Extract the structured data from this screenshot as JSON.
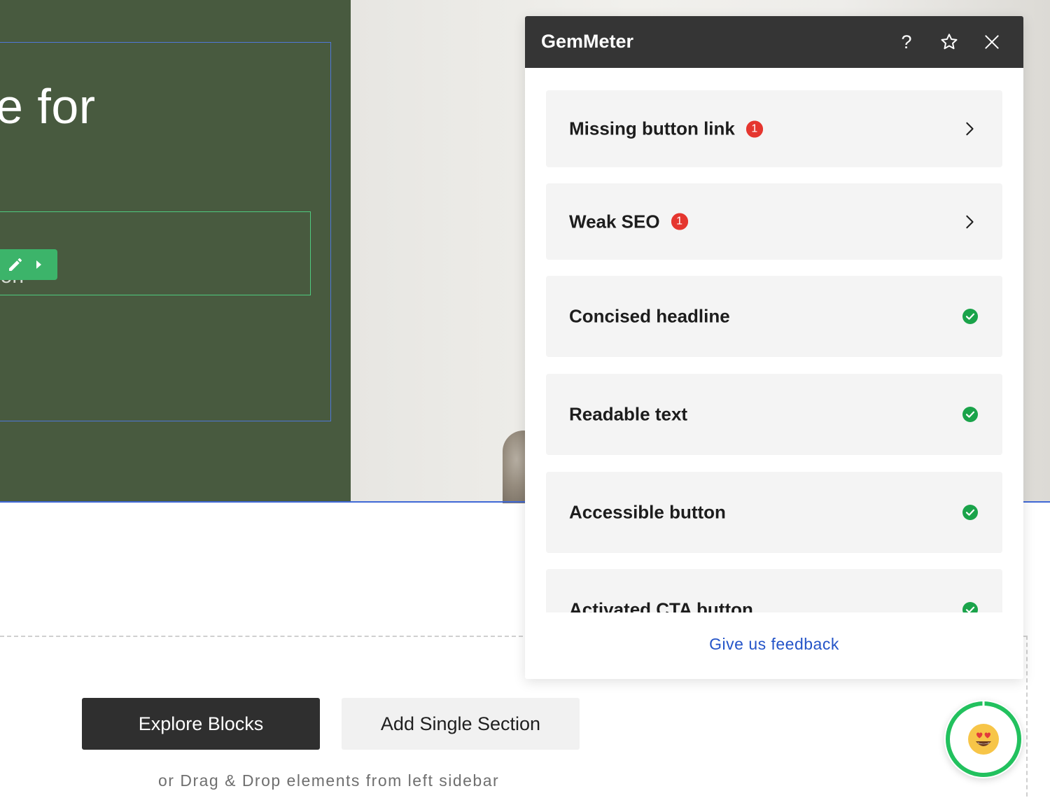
{
  "canvas": {
    "heading_fragment": "e for",
    "subtext_fragment": "ion"
  },
  "drop_zone": {
    "explore_label": "Explore Blocks",
    "add_section_label": "Add Single Section",
    "hint": "or Drag & Drop elements from left sidebar"
  },
  "panel": {
    "title": "GemMeter",
    "help_glyph": "?",
    "items": [
      {
        "label": "Missing button link",
        "status": "issue",
        "count": "1"
      },
      {
        "label": "Weak SEO",
        "status": "issue",
        "count": "1"
      },
      {
        "label": "Concised headline",
        "status": "ok"
      },
      {
        "label": "Readable text",
        "status": "ok"
      },
      {
        "label": "Accessible button",
        "status": "ok"
      },
      {
        "label": "Activated CTA button",
        "status": "ok"
      }
    ],
    "feedback_label": "Give us feedback"
  },
  "score_widget": {
    "emoji": "heart-eyes-face-icon"
  },
  "colors": {
    "hero_green": "#485a3f",
    "accent_blue": "#2454c8",
    "issue_red": "#e5362f",
    "ok_green": "#1aa34a",
    "ring_green": "#22c15e"
  }
}
